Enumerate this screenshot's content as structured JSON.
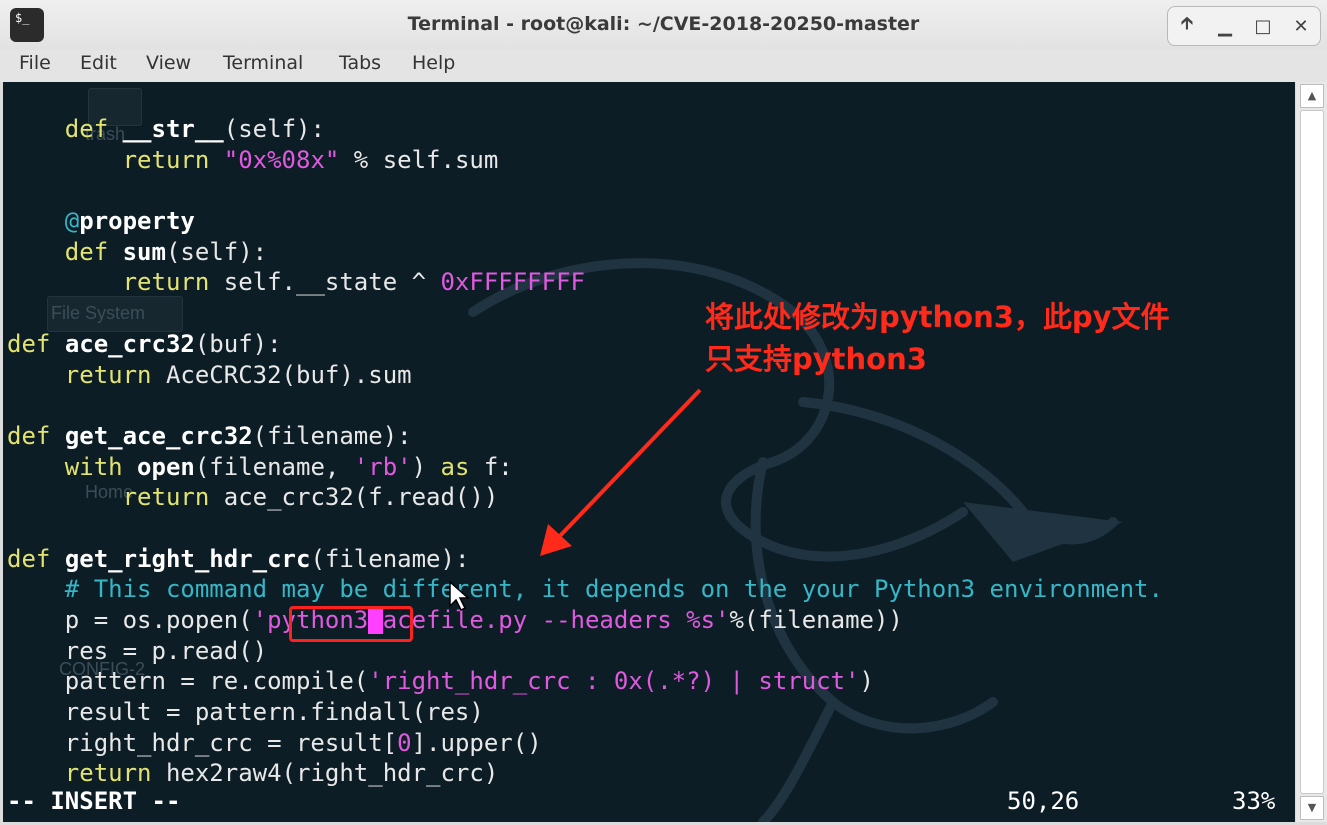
{
  "window": {
    "title": "Terminal - root@kali: ~/CVE-2018-20250-master",
    "app_icon_text": "$_"
  },
  "menubar": [
    "File",
    "Edit",
    "View",
    "Terminal",
    "Tabs",
    "Help"
  ],
  "desktop_ghosts": [
    "trash",
    "File System",
    "Home",
    "CONFIG-2"
  ],
  "editor": {
    "lines": [
      [
        [
          "    ",
          ""
        ],
        [
          "def",
          "kw"
        ],
        [
          " ",
          ""
        ],
        [
          "__str__",
          "fn"
        ],
        [
          "(self):",
          ""
        ]
      ],
      [
        [
          "        ",
          ""
        ],
        [
          "return",
          "kw"
        ],
        [
          " ",
          ""
        ],
        [
          "\"0x%08x\"",
          "str"
        ],
        [
          " % self.sum",
          ""
        ]
      ],
      [
        [
          "",
          ""
        ]
      ],
      [
        [
          "    ",
          ""
        ],
        [
          "@",
          "cm"
        ],
        [
          "property",
          "fn"
        ]
      ],
      [
        [
          "    ",
          ""
        ],
        [
          "def",
          "kw"
        ],
        [
          " ",
          ""
        ],
        [
          "sum",
          "fn"
        ],
        [
          "(self):",
          ""
        ]
      ],
      [
        [
          "        ",
          ""
        ],
        [
          "return",
          "kw"
        ],
        [
          " self.__state ^ ",
          ""
        ],
        [
          "0xFFFFFFFF",
          "num"
        ]
      ],
      [
        [
          "",
          ""
        ]
      ],
      [
        [
          "def",
          "kw"
        ],
        [
          " ",
          ""
        ],
        [
          "ace_crc32",
          "fn"
        ],
        [
          "(buf):",
          ""
        ]
      ],
      [
        [
          "    ",
          ""
        ],
        [
          "return",
          "kw"
        ],
        [
          " AceCRC32(buf).sum",
          ""
        ]
      ],
      [
        [
          "",
          ""
        ]
      ],
      [
        [
          "def",
          "kw"
        ],
        [
          " ",
          ""
        ],
        [
          "get_ace_crc32",
          "fn"
        ],
        [
          "(filename):",
          ""
        ]
      ],
      [
        [
          "    ",
          ""
        ],
        [
          "with",
          "kw"
        ],
        [
          " ",
          ""
        ],
        [
          "open",
          "fn"
        ],
        [
          "(filename, ",
          ""
        ],
        [
          "'rb'",
          "str"
        ],
        [
          ") ",
          ""
        ],
        [
          "as",
          "kw"
        ],
        [
          " f:",
          ""
        ]
      ],
      [
        [
          "        ",
          ""
        ],
        [
          "return",
          "kw"
        ],
        [
          " ace_crc32(f.read())",
          ""
        ]
      ],
      [
        [
          "",
          ""
        ]
      ],
      [
        [
          "def",
          "kw"
        ],
        [
          " ",
          ""
        ],
        [
          "get_right_hdr_crc",
          "fn"
        ],
        [
          "(filename):",
          ""
        ]
      ],
      [
        [
          "    ",
          ""
        ],
        [
          "# This command may be different, it depends on the your Python3 environment.",
          "cm"
        ]
      ],
      [
        [
          "    p = os.popen(",
          ""
        ],
        [
          "'python3",
          "str"
        ],
        [
          " ",
          "cursor"
        ],
        [
          "acefile.py --headers %s'",
          "str"
        ],
        [
          "%(filename))",
          ""
        ]
      ],
      [
        [
          "    res = p.read()",
          ""
        ]
      ],
      [
        [
          "    pattern = re.compile(",
          ""
        ],
        [
          "'right_hdr_crc : 0x(.*?) | struct'",
          "str"
        ],
        [
          ")",
          ""
        ]
      ],
      [
        [
          "    result = pattern.findall(res)",
          ""
        ]
      ],
      [
        [
          "    right_hdr_crc = result[",
          ""
        ],
        [
          "0",
          "num"
        ],
        [
          "].upper()",
          ""
        ]
      ],
      [
        [
          "    ",
          ""
        ],
        [
          "return",
          "kw"
        ],
        [
          " hex2raw4(right_hdr_crc)",
          ""
        ]
      ]
    ]
  },
  "status": {
    "mode": "-- INSERT --",
    "position": "50,26",
    "percent": "33%"
  },
  "annotation": {
    "text": "将此处修改为python3，此py文件\n只支持python3",
    "color": "#ff2a1a"
  },
  "colors": {
    "keyword": "#e3e370",
    "string": "#e05ae0",
    "comment": "#35b7c7",
    "background": "#0d1d26"
  }
}
